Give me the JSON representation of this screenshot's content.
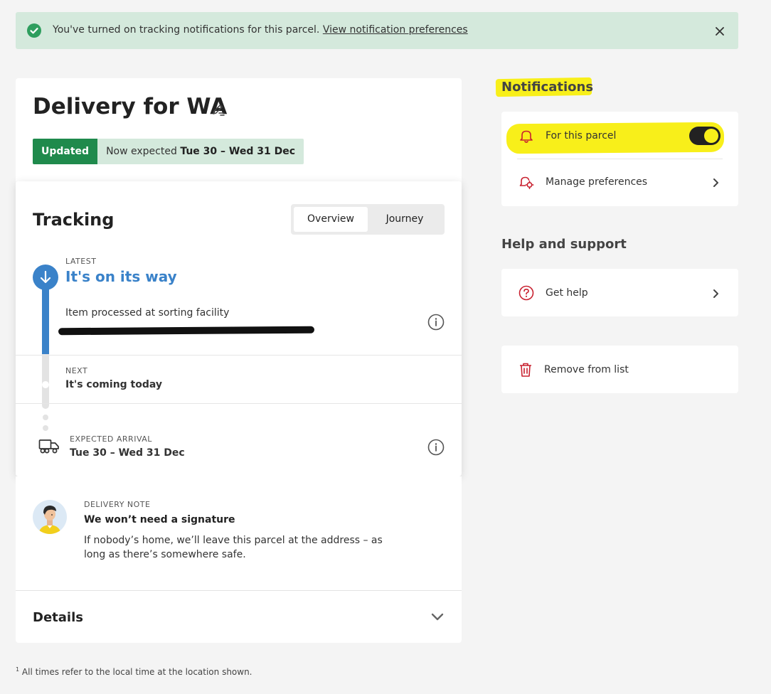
{
  "banner": {
    "message": "You've turned on tracking notifications for this parcel.",
    "link": "View notification preferences"
  },
  "delivery": {
    "title": "Delivery for WA",
    "status_badge": "Updated",
    "expected_prefix": "Now expected ",
    "expected_dates": "Tue 30 – Wed 31 Dec"
  },
  "tracking": {
    "title": "Tracking",
    "tabs": [
      "Overview",
      "Journey"
    ],
    "active_tab": "Overview",
    "latest_label": "LATEST",
    "latest_status": "It's on its way",
    "latest_event": "Item processed at sorting facility",
    "next_label": "NEXT",
    "next_status": "It's coming today",
    "arrival_label": "EXPECTED ARRIVAL",
    "arrival_dates": "Tue 30 – Wed 31 Dec"
  },
  "delivery_note": {
    "label": "DELIVERY NOTE",
    "heading": "We won’t need a signature",
    "body": "If nobody’s home, we’ll leave this parcel at the address – as long as there’s somewhere safe."
  },
  "details": {
    "label": "Details"
  },
  "footnote": {
    "marker": "1",
    "text": " All times refer to the local time at the location shown."
  },
  "notifications": {
    "heading": "Notifications",
    "for_parcel": "For this parcel",
    "for_parcel_enabled": true,
    "manage": "Manage preferences"
  },
  "help": {
    "heading": "Help and support",
    "get_help": "Get help",
    "remove": "Remove from list"
  },
  "colors": {
    "success_green": "#1f8a4c",
    "accent_blue": "#3a82c9",
    "highlight_yellow": "#f8ef1a",
    "icon_red": "#c8202f"
  }
}
